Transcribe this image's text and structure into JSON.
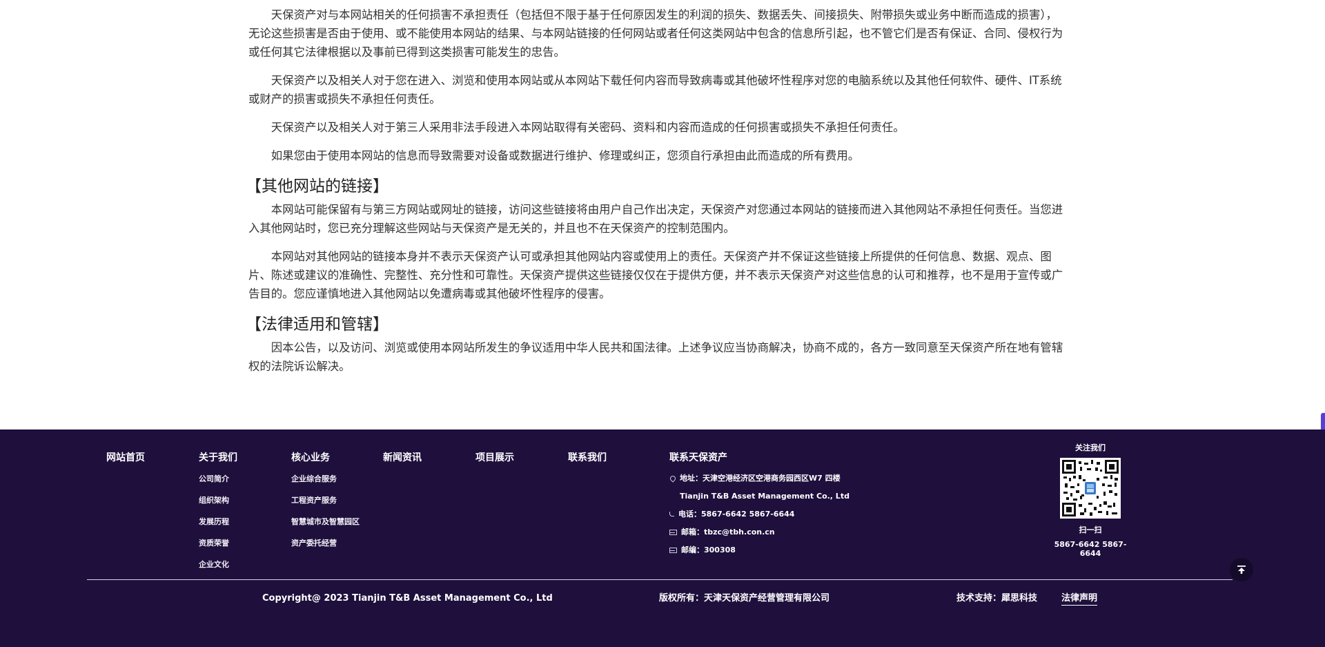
{
  "article": {
    "p1": "天保资产对与本网站相关的任何损害不承担责任（包括但不限于基于任何原因发生的利润的损失、数据丢失、间接损失、附带损失或业务中断而造成的损害），无论这些损害是否由于使用、或不能使用本网站的结果、与本网站链接的任何网站或者任何这类网站中包含的信息所引起，也不管它们是否有保证、合同、侵权行为或任何其它法律根据以及事前已得到这类损害可能发生的忠告。",
    "p2": "天保资产以及相关人对于您在进入、浏览和使用本网站或从本网站下载任何内容而导致病毒或其他破坏性程序对您的电脑系统以及其他任何软件、硬件、IT系统或财产的损害或损失不承担任何责任。",
    "p3": "天保资产以及相关人对于第三人采用非法手段进入本网站取得有关密码、资料和内容而造成的任何损害或损失不承担任何责任。",
    "p4": "如果您由于使用本网站的信息而导致需要对设备或数据进行维护、修理或纠正，您须自行承担由此而造成的所有费用。",
    "h_links": "【其他网站的链接】",
    "p5": "本网站可能保留有与第三方网站或网址的链接，访问这些链接将由用户自己作出决定，天保资产对您通过本网站的链接而进入其他网站不承担任何责任。当您进入其他网站时，您已充分理解这些网站与天保资产是无关的，并且也不在天保资产的控制范围内。",
    "p6": "本网站对其他网站的链接本身并不表示天保资产认可或承担其他网站内容或使用上的责任。天保资产并不保证这些链接上所提供的任何信息、数据、观点、图片、陈述或建议的准确性、完整性、充分性和可靠性。天保资产提供这些链接仅仅在于提供方便，并不表示天保资产对这些信息的认可和推荐，也不是用于宣传或广告目的。您应谨慎地进入其他网站以免遭病毒或其他破坏性程序的侵害。",
    "h_law": "【法律适用和管辖】",
    "p7": "因本公告，以及访问、浏览或使用本网站所发生的争议适用中华人民共和国法律。上述争议应当协商解决，协商不成的，各方一致同意至天保资产所在地有管辖权的法院诉讼解决。"
  },
  "footer": {
    "nav": [
      {
        "label": "网站首页",
        "items": []
      },
      {
        "label": "关于我们",
        "items": [
          "公司简介",
          "组织架构",
          "发展历程",
          "资质荣誉",
          "企业文化"
        ]
      },
      {
        "label": "核心业务",
        "items": [
          "企业综合服务",
          "工程资产服务",
          "智慧城市及智慧园区",
          "资产委托经营"
        ]
      },
      {
        "label": "新闻资讯",
        "items": []
      },
      {
        "label": "项目展示",
        "items": []
      },
      {
        "label": "联系我们",
        "items": []
      }
    ],
    "contact": {
      "title": "联系天保资产",
      "address": "地址：天津空港经济区空港商务园西区W7 四楼",
      "company_en": "Tianjin T&B Asset Management Co., Ltd",
      "phone": "电话：5867-6642 5867-6644",
      "email": "邮箱：tbzc@tbh.con.cn",
      "postcode": "邮编：300308"
    },
    "follow": {
      "title": "关注我们",
      "scan": "扫一扫",
      "phone": "5867-6642 5867-6644"
    },
    "copyright": "Copyright@ 2023 Tianjin T&B Asset Management Co., Ltd",
    "rights": "版权所有：天津天保资产经营管理有限公司",
    "tech_support": "技术支持：犀思科技",
    "legal": "法律声明",
    "icons": [
      "location-pin-icon",
      "phone-icon",
      "mail-icon",
      "postcode-icon",
      "qr-code",
      "arrow-up-icon"
    ],
    "colors": {
      "footer_bg": "#1e0f3c",
      "accent": "#5a3fd6"
    }
  }
}
